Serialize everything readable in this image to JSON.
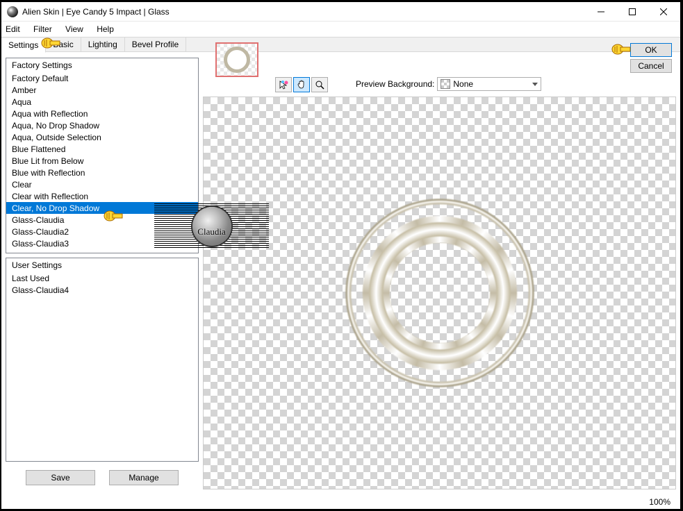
{
  "title": "Alien Skin | Eye Candy 5 Impact | Glass",
  "menu": {
    "edit": "Edit",
    "filter": "Filter",
    "view": "View",
    "help": "Help"
  },
  "tabs": {
    "settings": "Settings",
    "basic": "Basic",
    "lighting": "Lighting",
    "bevel": "Bevel Profile"
  },
  "buttons": {
    "ok": "OK",
    "cancel": "Cancel",
    "save": "Save",
    "manage": "Manage"
  },
  "factory_header": "Factory Settings",
  "factory_items": [
    "Factory Default",
    "Amber",
    "Aqua",
    "Aqua with Reflection",
    "Aqua, No Drop Shadow",
    "Aqua, Outside Selection",
    "Blue Flattened",
    "Blue Lit from Below",
    "Blue with Reflection",
    "Clear",
    "Clear with Reflection",
    "Clear, No Drop Shadow",
    "Glass-Claudia",
    "Glass-Claudia2",
    "Glass-Claudia3"
  ],
  "selected_index": 11,
  "user_header": "User Settings",
  "user_items": [
    "Last Used",
    "Glass-Claudia4"
  ],
  "preview_bg_label": "Preview Background:",
  "preview_bg_value": "None",
  "zoom": "100%",
  "watermark": "Claudia",
  "icons": {
    "pointer": "pointer-icon",
    "hand": "hand-icon",
    "zoom": "zoom-icon"
  }
}
